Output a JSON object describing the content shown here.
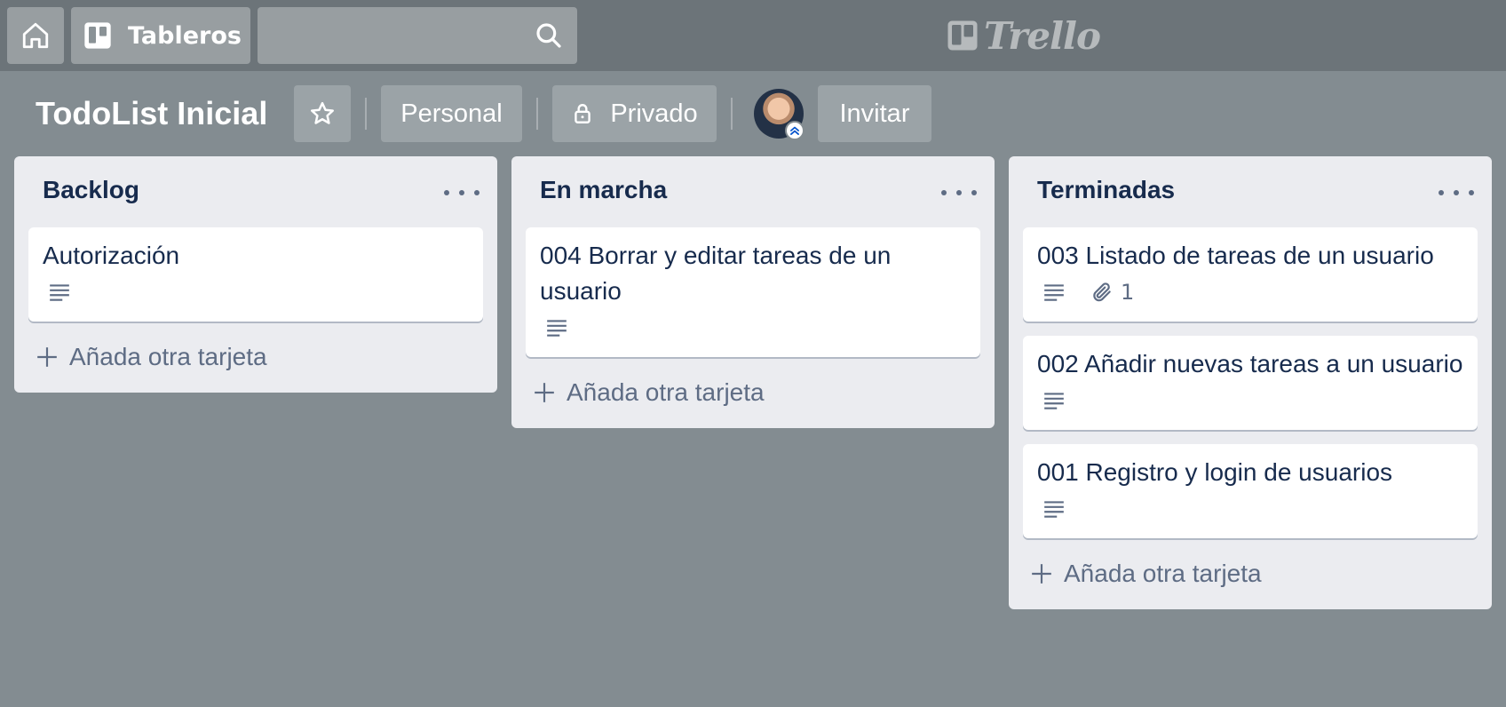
{
  "topbar": {
    "home_icon": "home-icon",
    "boards_label": "Tableros",
    "search_placeholder": "",
    "logo_text": "Trello"
  },
  "board": {
    "title": "TodoList Inicial",
    "team_label": "Personal",
    "visibility_label": "Privado",
    "invite_label": "Invitar"
  },
  "lists": [
    {
      "title": "Backlog",
      "cards": [
        {
          "title": "Autorización",
          "has_description": true
        }
      ],
      "add_label": "Añada otra tarjeta"
    },
    {
      "title": "En marcha",
      "cards": [
        {
          "title": "004 Borrar y editar tareas de un usuario",
          "has_description": true
        }
      ],
      "add_label": "Añada otra tarjeta"
    },
    {
      "title": "Terminadas",
      "cards": [
        {
          "title": "003 Listado de tareas de un usuario",
          "has_description": true,
          "attachments": "1"
        },
        {
          "title": "002 Añadir nuevas tareas a un usuario",
          "has_description": true
        },
        {
          "title": "001 Registro y login de usuarios",
          "has_description": true
        }
      ],
      "add_label": "Añada otra tarjeta"
    }
  ],
  "colors": {
    "background": "#838c91",
    "header": "#6c7479",
    "list": "#ebecf0",
    "card": "#ffffff",
    "text": "#172b4d",
    "muted": "#5e6c84"
  }
}
